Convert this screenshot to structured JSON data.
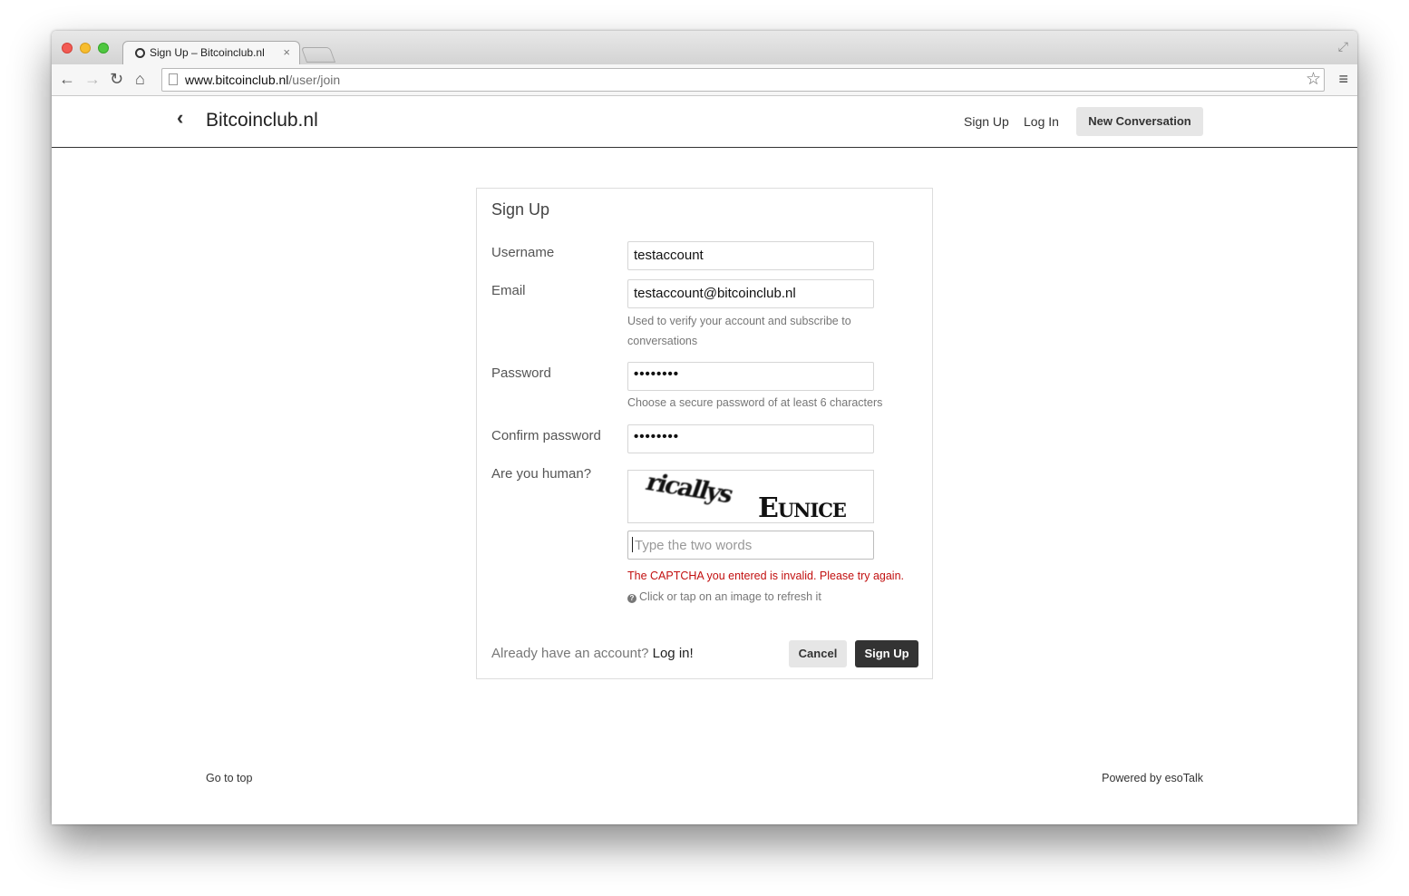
{
  "browser": {
    "tab_title": "Sign Up – Bitcoinclub.nl",
    "tab_close": "×",
    "url_domain": "www.bitcoinclub.nl",
    "url_path": "/user/join",
    "icons": {
      "back": "←",
      "forward": "→",
      "reload": "↻",
      "home": "⌂",
      "star": "☆",
      "menu": "≡",
      "fullscreen": "⤢"
    }
  },
  "header": {
    "back_icon": "‹",
    "site_title": "Bitcoinclub.nl",
    "signup_link": "Sign Up",
    "login_link": "Log In",
    "new_conversation": "New Conversation"
  },
  "form": {
    "title": "Sign Up",
    "username_label": "Username",
    "username_value": "testaccount",
    "email_label": "Email",
    "email_value": "testaccount@bitcoinclub.nl",
    "email_help": "Used to verify your account and subscribe to conversations",
    "password_label": "Password",
    "password_value": "••••••••",
    "password_help": "Choose a secure password of at least 6 characters",
    "confirm_label": "Confirm password",
    "confirm_value": "••••••••",
    "human_label": "Are you human?",
    "captcha_word1": "ricallys",
    "captcha_word2": "Eunice",
    "captcha_placeholder": "Type the two words",
    "captcha_error": "The CAPTCHA you entered is invalid. Please try again.",
    "captcha_hint_icon": "?",
    "captcha_hint": "Click or tap on an image to refresh it",
    "already_text": "Already have an account?",
    "login_link": "Log in!",
    "cancel_button": "Cancel",
    "submit_button": "Sign Up"
  },
  "footer": {
    "go_to_top": "Go to top",
    "powered_by": "Powered by",
    "esotalk": "esoTalk"
  }
}
